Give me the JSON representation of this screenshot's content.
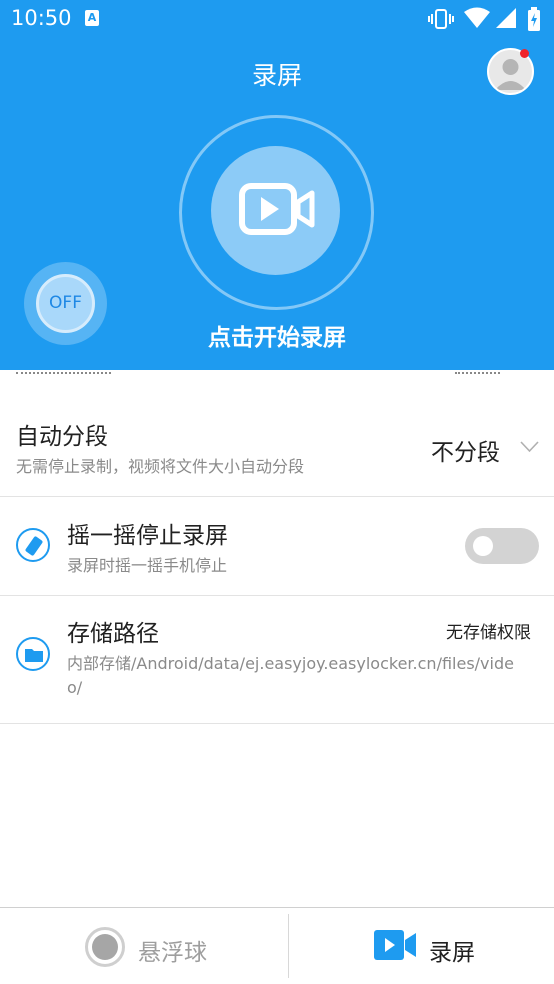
{
  "status_bar": {
    "time": "10:50",
    "notification_icon": "A"
  },
  "header": {
    "title": "录屏",
    "start_label": "点击开始录屏",
    "float_toggle_label": "OFF"
  },
  "settings": {
    "auto_split": {
      "title": "自动分段",
      "subtitle": "无需停止录制，视频将文件大小自动分段",
      "value": "不分段"
    },
    "shake_stop": {
      "title": "摇一摇停止录屏",
      "subtitle": "录屏时摇一摇手机停止",
      "enabled": false
    },
    "storage": {
      "title": "存储路径",
      "status": "无存储权限",
      "path": "内部存储/Android/data/ej.easyjoy.easylocker.cn/files/video/"
    }
  },
  "bottom_nav": {
    "tabs": [
      {
        "label": "悬浮球",
        "icon": "floating-ball-icon",
        "active": false
      },
      {
        "label": "录屏",
        "icon": "video-camera-icon",
        "active": true
      }
    ]
  },
  "colors": {
    "accent": "#1e9bf0",
    "switch_off": "#d3d3d3",
    "notification_dot": "#f0242a"
  }
}
